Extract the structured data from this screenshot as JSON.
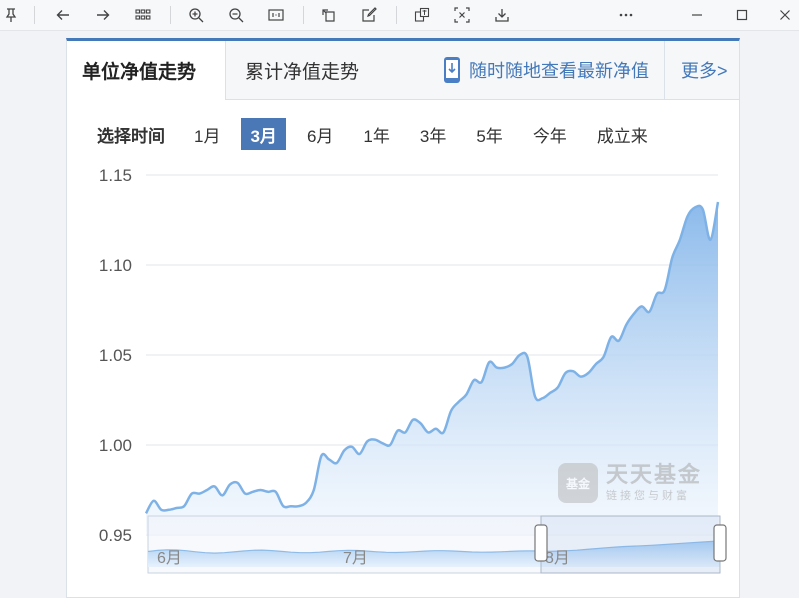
{
  "toolbar": {
    "icons": [
      "pin-icon",
      "back-arrow-icon",
      "forward-arrow-icon",
      "grid-icon",
      "zoom-in-icon",
      "zoom-out-icon",
      "fit-page-icon",
      "rotate-icon",
      "edit-icon",
      "translate-icon",
      "crop-icon",
      "download-icon",
      "more-icon",
      "minimize-icon",
      "maximize-icon",
      "close-icon"
    ]
  },
  "tabs": {
    "active": "单位净值走势",
    "second": "累计净值走势",
    "mobile": "随时随地查看最新净值",
    "more": "更多>"
  },
  "range": {
    "label": "选择时间",
    "options": [
      "1月",
      "3月",
      "6月",
      "1年",
      "3年",
      "5年",
      "今年",
      "成立来"
    ],
    "selected": "3月"
  },
  "colors": {
    "accent": "#4378b9",
    "line": "#7eb2e6",
    "area_top": "#85b6ea",
    "area_bottom": "#eef5fd"
  },
  "watermark": {
    "mark": "基金",
    "name": "天天基金",
    "slogan": "链接您与财富"
  },
  "chart_data": {
    "type": "area",
    "title": "",
    "xlabel": "",
    "ylabel": "",
    "ylim": [
      0.95,
      1.15
    ],
    "yticks": [
      "0.95",
      "1.00",
      "1.05",
      "1.10",
      "1.15"
    ],
    "grid": true,
    "series": [
      {
        "values": [
          0.962,
          0.969,
          0.964,
          0.964,
          0.965,
          0.966,
          0.973,
          0.973,
          0.975,
          0.977,
          0.972,
          0.978,
          0.979,
          0.973,
          0.974,
          0.975,
          0.974,
          0.974,
          0.966,
          0.966,
          0.966,
          0.968,
          0.975,
          0.994,
          0.992,
          0.99,
          0.997,
          0.999,
          0.995,
          1.002,
          1.003,
          1.001,
          1.0,
          1.008,
          1.007,
          1.014,
          1.012,
          1.007,
          1.009,
          1.007,
          1.019,
          1.024,
          1.028,
          1.036,
          1.035,
          1.046,
          1.043,
          1.043,
          1.045,
          1.05,
          1.049,
          1.027,
          1.026,
          1.029,
          1.032,
          1.04,
          1.041,
          1.038,
          1.04,
          1.045,
          1.049,
          1.06,
          1.058,
          1.067,
          1.073,
          1.077,
          1.074,
          1.084,
          1.086,
          1.104,
          1.114,
          1.127,
          1.132,
          1.131,
          1.114,
          1.135
        ]
      }
    ],
    "navigator": {
      "labels": [
        "6月",
        "7月",
        "8月"
      ]
    }
  }
}
